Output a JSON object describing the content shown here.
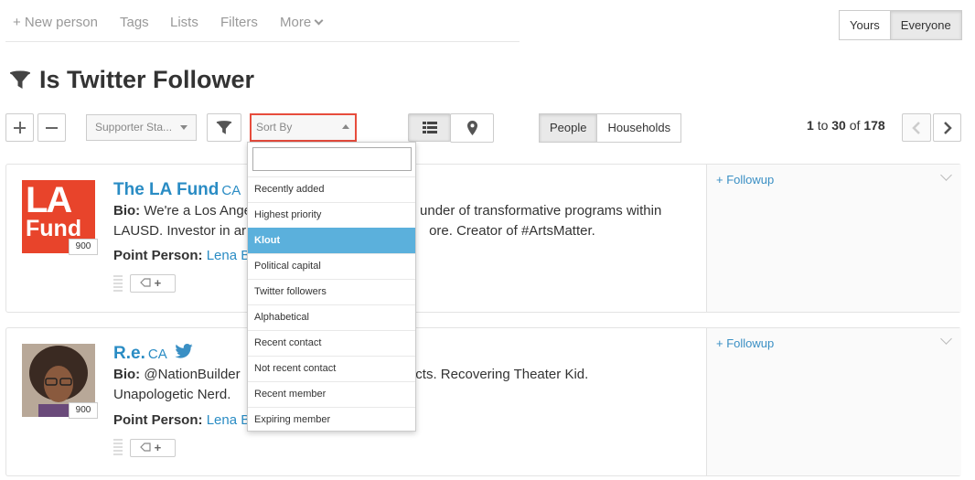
{
  "nav": {
    "new_person": "+ New person",
    "tags": "Tags",
    "lists": "Lists",
    "filters": "Filters",
    "more": "More"
  },
  "scope": {
    "yours": "Yours",
    "everyone": "Everyone",
    "selected": "everyone"
  },
  "page": {
    "title": "Is Twitter Follower"
  },
  "toolbar": {
    "supporter_status": "Supporter Sta...",
    "sort_by": "Sort By",
    "view_people": "People",
    "view_households": "Households"
  },
  "pager": {
    "from": "1",
    "to_word": "to",
    "to": "30",
    "of_word": "of",
    "total": "178"
  },
  "sort_menu": {
    "search_value": "",
    "options": [
      "Recently added",
      "Highest priority",
      "Klout",
      "Political capital",
      "Twitter followers",
      "Alphabetical",
      "Recent contact",
      "Not recent contact",
      "Recent member",
      "Expiring member"
    ],
    "highlighted": "Klout"
  },
  "people": [
    {
      "name": "The LA Fund",
      "state": "CA",
      "score": "900",
      "bio_label": "Bio:",
      "bio_start": "We're a Los Ange",
      "bio_end": "under of transformative programs within",
      "bio_line2a": "LAUSD. Investor in ar",
      "bio_line2b": "ore. Creator of #ArtsMatter.",
      "point_label": "Point Person:",
      "point_person": "Lena B",
      "followup": "+ Followup",
      "avatar_text_1": "LA",
      "avatar_text_2": "Fund"
    },
    {
      "name": "R.e.",
      "state": "CA",
      "score": "900",
      "bio_label": "Bio:",
      "bio_start": "@NationBuilder",
      "bio_end": "Objects. Recovering Theater Kid.",
      "bio_line2a": "Unapologetic Nerd.",
      "bio_line2b": "",
      "point_label": "Point Person:",
      "point_person": "Lena B",
      "followup": "+ Followup"
    }
  ],
  "colors": {
    "link": "#2a8cc4",
    "highlight": "#5bb0dc",
    "focus_outline": "#e74c3c",
    "la_fund_red": "#e8442b"
  },
  "icons": [
    "plus-icon",
    "minus-icon",
    "filter-icon",
    "list-view-icon",
    "map-pin-icon",
    "chevron-left-icon",
    "chevron-right-icon",
    "twitter-icon",
    "tag-icon",
    "chevron-down-icon"
  ]
}
